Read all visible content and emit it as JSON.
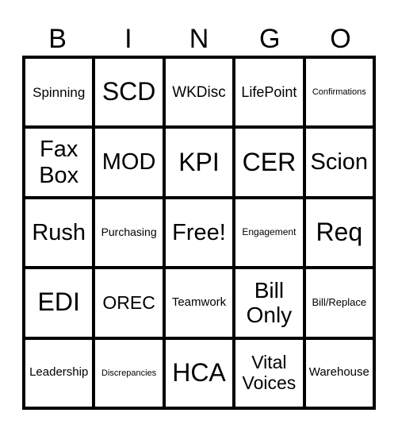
{
  "header": [
    "B",
    "I",
    "N",
    "G",
    "O"
  ],
  "cells": [
    {
      "text": "Spinning",
      "size": 17
    },
    {
      "text": "SCD",
      "size": 32
    },
    {
      "text": "WKDisc",
      "size": 19
    },
    {
      "text": "LifePoint",
      "size": 18
    },
    {
      "text": "Confirmations",
      "size": 11
    },
    {
      "text": "Fax Box",
      "size": 29
    },
    {
      "text": "MOD",
      "size": 29
    },
    {
      "text": "KPI",
      "size": 32
    },
    {
      "text": "CER",
      "size": 32
    },
    {
      "text": "Scion",
      "size": 29
    },
    {
      "text": "Rush",
      "size": 29
    },
    {
      "text": "Purchasing",
      "size": 14
    },
    {
      "text": "Free!",
      "size": 29
    },
    {
      "text": "Engagement",
      "size": 12
    },
    {
      "text": "Req",
      "size": 32
    },
    {
      "text": "EDI",
      "size": 32
    },
    {
      "text": "OREC",
      "size": 23
    },
    {
      "text": "Teamwork",
      "size": 15
    },
    {
      "text": "Bill Only",
      "size": 28
    },
    {
      "text": "Bill/Replace",
      "size": 13
    },
    {
      "text": "Leadership",
      "size": 15
    },
    {
      "text": "Discrepancies",
      "size": 11
    },
    {
      "text": "HCA",
      "size": 32
    },
    {
      "text": "Vital Voices",
      "size": 23
    },
    {
      "text": "Warehouse",
      "size": 15
    }
  ]
}
